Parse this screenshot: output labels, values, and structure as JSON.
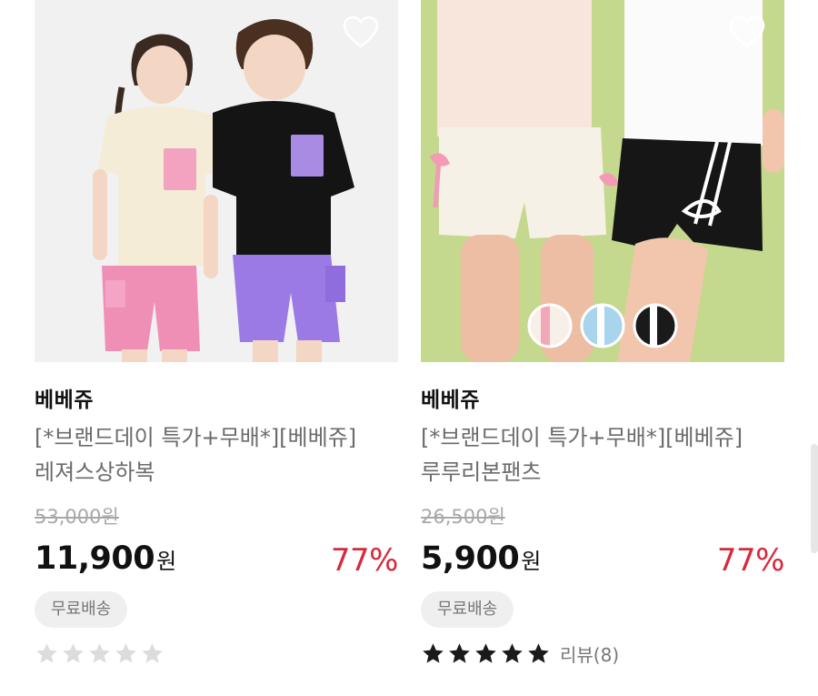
{
  "products": [
    {
      "brand": "베베쥬",
      "title": "[*브랜드데이 특가+무배*][베베쥬] 레져스상하복",
      "original_price": "53,000원",
      "price": "11,900",
      "currency": "원",
      "discount": "77%",
      "badge": "무료배송",
      "rating": 0,
      "reviews": "",
      "photo": "two kids in t-shirts with cargo shorts"
    },
    {
      "brand": "베베쥬",
      "title": "[*브랜드데이 특가+무배*][베베쥬] 루루리본팬츠",
      "original_price": "26,500원",
      "price": "5,900",
      "currency": "원",
      "discount": "77%",
      "badge": "무료배송",
      "rating": 5,
      "reviews": "리뷰(8)",
      "swatches": [
        "#f2a8b8",
        "#a9d4ee",
        "#1a1a1a"
      ],
      "photo": "kids wearing ribbon shorts"
    }
  ],
  "icons": {
    "wishlist": "heart-outline-icon",
    "star": "star-icon"
  },
  "colors": {
    "discount": "#d8283a",
    "star_filled": "#1a1a1a",
    "star_empty": "#dcdcdc"
  }
}
